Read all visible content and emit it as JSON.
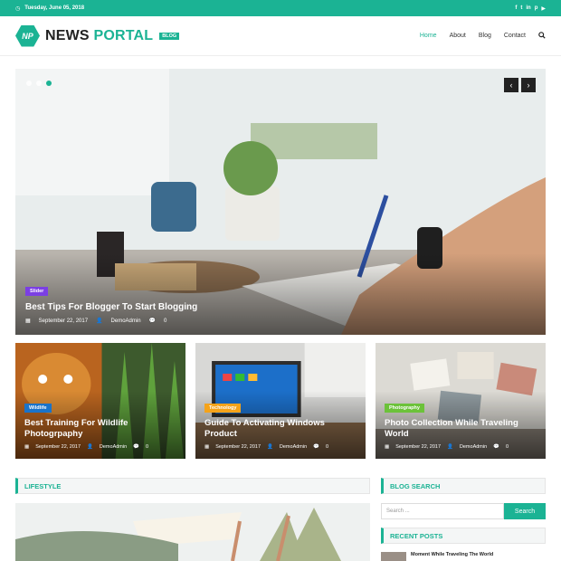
{
  "topbar": {
    "date": "Tuesday, June 05, 2018",
    "socials": [
      "f",
      "t",
      "in",
      "p",
      "yt"
    ]
  },
  "brand": {
    "badge": "NP",
    "name_part1": "NEWS",
    "name_part2": "PORTAL",
    "tag": "BLOG"
  },
  "nav": {
    "items": [
      "Home",
      "About",
      "Blog",
      "Contact"
    ]
  },
  "slider": {
    "category": "Slider",
    "category_color": "#7b3fe4",
    "title": "Best Tips For Blogger To Start Blogging",
    "date": "September 22, 2017",
    "author": "DemoAdmin",
    "comments": "0",
    "prev_icon": "chevron-left-icon",
    "next_icon": "chevron-right-icon"
  },
  "cards": [
    {
      "category": "Wildlife",
      "category_color": "#1a73c9",
      "title": "Best Training For Wildlife Photogrpaphy",
      "date": "September 22, 2017",
      "author": "DemoAdmin",
      "comments": "0"
    },
    {
      "category": "Technology",
      "category_color": "#f5a31a",
      "title": "Guide To Activating Windows Product",
      "date": "September 22, 2017",
      "author": "DemoAdmin",
      "comments": "0"
    },
    {
      "category": "Photography",
      "category_color": "#6cc23a",
      "title": "Photo Collection While Traveling World",
      "date": "September 22, 2017",
      "author": "DemoAdmin",
      "comments": "0"
    }
  ],
  "sections": {
    "lifestyle": "LIFESTYLE",
    "blog_search": "BLOG SEARCH",
    "recent_posts": "RECENT POSTS"
  },
  "search": {
    "placeholder": "Search ...",
    "button": "Search"
  },
  "recent": {
    "first_title": "Moment While Traveling The World"
  },
  "colors": {
    "accent": "#1bb394"
  }
}
